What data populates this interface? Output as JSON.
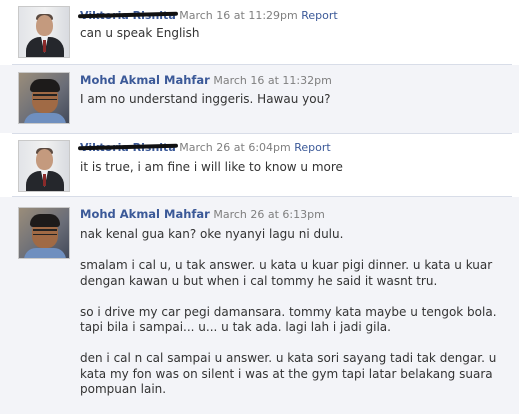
{
  "posts": [
    {
      "author": "Viktoria Risnita",
      "author_redacted": true,
      "time": "March 16 at 11:29pm",
      "action": "Report",
      "paragraphs": [
        "can u speak English"
      ],
      "avatar": "man-in-suit-avatar"
    },
    {
      "author": "Mohd Akmal Mahfar",
      "author_redacted": false,
      "time": "March 16 at 11:32pm",
      "action": "",
      "paragraphs": [
        "I am no understand inggeris. Hawau you?"
      ],
      "avatar": "young-man-glasses-avatar"
    },
    {
      "author": "Viktoria Risnita",
      "author_redacted": true,
      "time": "March 26 at 6:04pm",
      "action": "Report",
      "paragraphs": [
        "it is true, i am fine i will like to know u more"
      ],
      "avatar": "man-in-suit-avatar"
    },
    {
      "author": "Mohd Akmal Mahfar",
      "author_redacted": false,
      "time": "March 26 at 6:13pm",
      "action": "",
      "paragraphs": [
        "nak kenal gua kan? oke nyanyi lagu ni dulu.",
        "smalam i cal u, u tak answer. u kata u kuar pigi dinner. u kata u kuar dengan kawan u but when i cal tommy he said it wasnt tru.",
        "so i drive my car pegi damansara. tommy kata maybe u tengok bola. tapi bila i sampai... u... u tak ada. lagi lah i jadi gila.",
        "den i cal n cal sampai u answer. u kata sori sayang tadi tak dengar. u kata my fon was on silent i was at the gym tapi latar belakang suara pompuan lain."
      ],
      "avatar": "young-man-glasses-avatar"
    }
  ]
}
